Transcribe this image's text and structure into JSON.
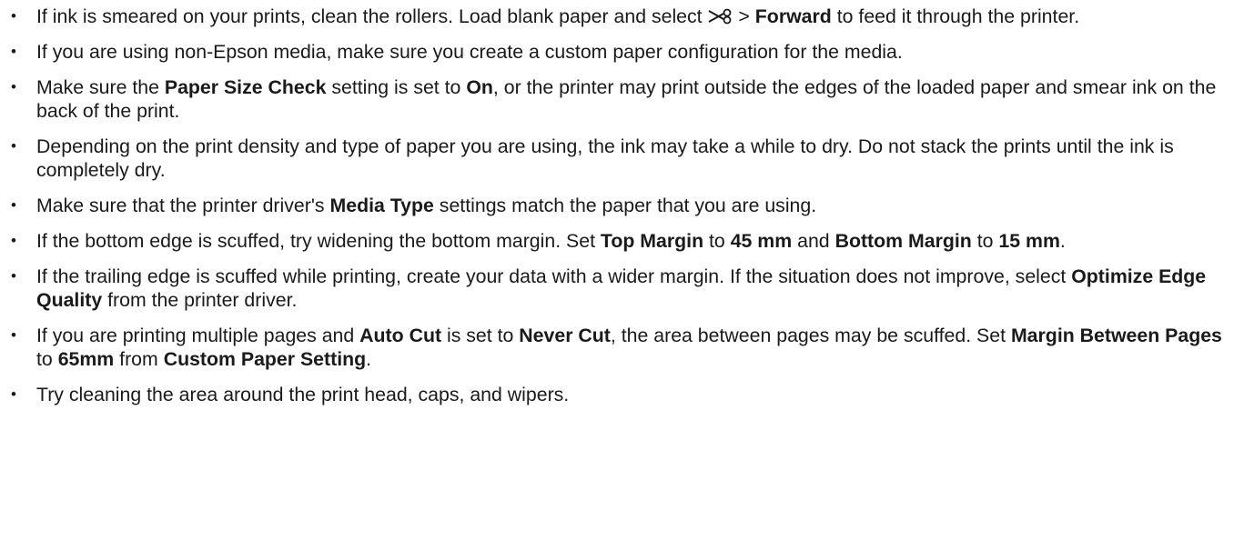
{
  "bullet_char": "•",
  "items": [
    {
      "parts": [
        {
          "t": "If ink is smeared on your prints, clean the rollers. Load blank paper and select "
        },
        {
          "icon": "scissors-icon"
        },
        {
          "t": " > "
        },
        {
          "t": "Forward",
          "b": true
        },
        {
          "t": " to feed it through the printer."
        }
      ]
    },
    {
      "parts": [
        {
          "t": "If you are using non-Epson media, make sure you create a custom paper configuration for the media."
        }
      ]
    },
    {
      "parts": [
        {
          "t": "Make sure the "
        },
        {
          "t": "Paper Size Check",
          "b": true
        },
        {
          "t": " setting is set to "
        },
        {
          "t": "On",
          "b": true
        },
        {
          "t": ", or the printer may print outside the edges of the loaded paper and smear ink on the back of the print."
        }
      ]
    },
    {
      "parts": [
        {
          "t": "Depending on the print density and type of paper you are using, the ink may take a while to dry. Do not stack the prints until the ink is completely dry."
        }
      ]
    },
    {
      "parts": [
        {
          "t": "Make sure that the printer driver's "
        },
        {
          "t": "Media Type",
          "b": true
        },
        {
          "t": " settings match the paper that you are using."
        }
      ]
    },
    {
      "parts": [
        {
          "t": "If the bottom edge is scuffed, try widening the bottom margin. Set "
        },
        {
          "t": "Top Margin",
          "b": true
        },
        {
          "t": " to "
        },
        {
          "t": "45 mm",
          "b": true
        },
        {
          "t": " and "
        },
        {
          "t": "Bottom Margin",
          "b": true
        },
        {
          "t": " to "
        },
        {
          "t": "15 mm",
          "b": true
        },
        {
          "t": "."
        }
      ]
    },
    {
      "parts": [
        {
          "t": "If the trailing edge is scuffed while printing, create your data with a wider margin. If the situation does not improve, select "
        },
        {
          "t": "Optimize Edge Quality",
          "b": true
        },
        {
          "t": " from the printer driver."
        }
      ]
    },
    {
      "parts": [
        {
          "t": "If you are printing multiple pages and "
        },
        {
          "t": "Auto Cut",
          "b": true
        },
        {
          "t": " is set to "
        },
        {
          "t": "Never Cut",
          "b": true
        },
        {
          "t": ", the area between pages may be scuffed. Set "
        },
        {
          "t": "Margin Between Pages",
          "b": true
        },
        {
          "t": " to "
        },
        {
          "t": "65mm",
          "b": true
        },
        {
          "t": " from "
        },
        {
          "t": "Custom Paper Setting",
          "b": true
        },
        {
          "t": "."
        }
      ]
    },
    {
      "parts": [
        {
          "t": "Try cleaning the area around the print head, caps, and wipers."
        }
      ]
    }
  ]
}
